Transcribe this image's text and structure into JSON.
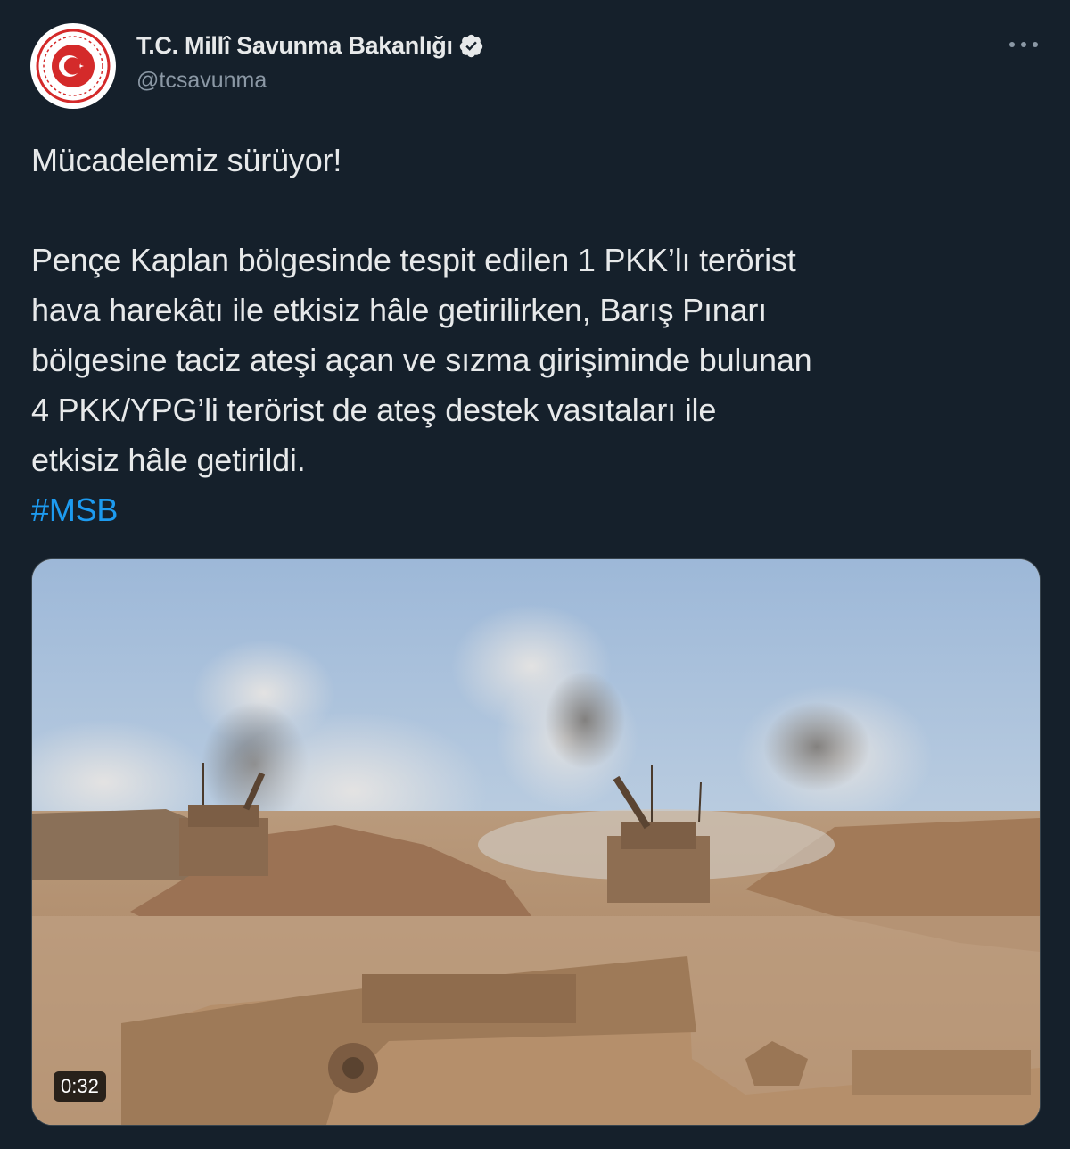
{
  "account": {
    "display_name": "T.C. Millî Savunma Bakanlığı",
    "handle": "@tcsavunma",
    "verified": true,
    "avatar_icon": "ministry-emblem-icon",
    "verified_icon": "verified-badge-icon",
    "more_icon": "more-options-icon"
  },
  "tweet": {
    "headline": "Mücadelemiz sürüyor!",
    "body_lines": [
      "Pençe Kaplan bölgesinde tespit edilen 1 PKK’lı terörist",
      "hava harekâtı ile etkisiz hâle getirilirken, Barış Pınarı",
      "bölgesine taciz ateşi açan ve sızma girişiminde bulunan",
      "4 PKK/YPG’li terörist de ateş destek vasıtaları ile",
      "etkisiz hâle getirildi."
    ],
    "hashtag": "#MSB"
  },
  "media": {
    "type": "video",
    "duration": "0:32"
  },
  "colors": {
    "background": "#15202b",
    "text": "#e7e9ea",
    "secondary_text": "#8b98a5",
    "link": "#1d9bf0",
    "emblem_red": "#d42a2a"
  }
}
